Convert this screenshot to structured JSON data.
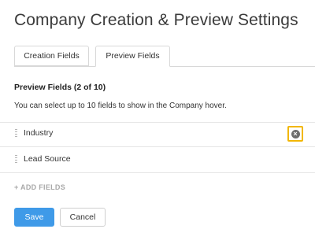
{
  "page": {
    "title": "Company Creation & Preview Settings"
  },
  "tabs": [
    {
      "label": "Creation Fields",
      "active": false
    },
    {
      "label": "Preview Fields",
      "active": true
    }
  ],
  "section": {
    "heading": "Preview Fields (2 of 10)",
    "description": "You can select up to 10 fields to show in the Company hover."
  },
  "fields": [
    {
      "label": "Industry",
      "remove_icon": "close-circle-icon"
    },
    {
      "label": "Lead Source"
    }
  ],
  "add_fields_label": "+ ADD FIELDS",
  "buttons": {
    "save": "Save",
    "cancel": "Cancel"
  },
  "colors": {
    "primary": "#3f9ae8",
    "highlight": "#f2b705"
  }
}
